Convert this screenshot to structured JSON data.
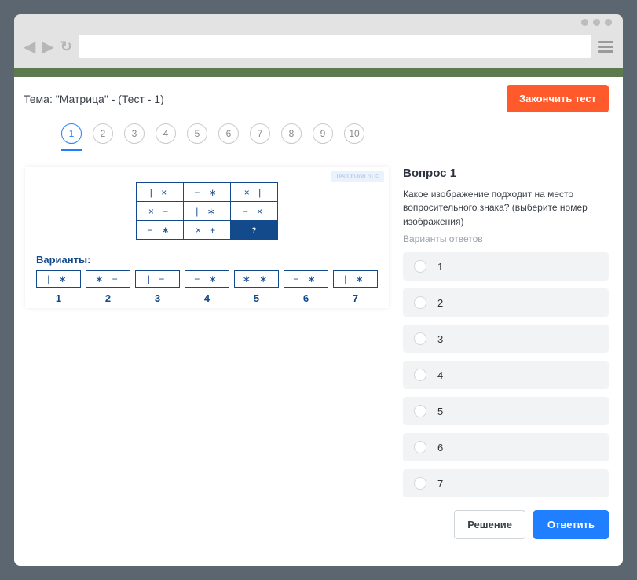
{
  "addressbar": {
    "value": ""
  },
  "topic": {
    "label": "Тема: \"Матрица\" - (Тест - 1)"
  },
  "buttons": {
    "finish": "Закончить тест",
    "solution": "Решение",
    "answer": "Ответить"
  },
  "nav": {
    "items": [
      "1",
      "2",
      "3",
      "4",
      "5",
      "6",
      "7",
      "8",
      "9",
      "10"
    ],
    "active_index": 0
  },
  "left": {
    "watermark": "TestOnJob.ru ©",
    "variants_label": "Варианты:",
    "matrix": [
      [
        "| ×",
        "− ∗",
        "× |"
      ],
      [
        "× −",
        "| ∗",
        "− ×"
      ],
      [
        "− ∗",
        "× +",
        "?"
      ]
    ],
    "variants": [
      {
        "num": "1",
        "pattern": "| ∗"
      },
      {
        "num": "2",
        "pattern": "∗ −"
      },
      {
        "num": "3",
        "pattern": "| −"
      },
      {
        "num": "4",
        "pattern": "− ∗"
      },
      {
        "num": "5",
        "pattern": "∗ ∗"
      },
      {
        "num": "6",
        "pattern": "− ∗"
      },
      {
        "num": "7",
        "pattern": "| ∗"
      }
    ]
  },
  "question": {
    "title": "Вопрос 1",
    "text": "Какое изображение подходит на место вопросительного знака? (выберите номер изображения)",
    "answers_label": "Варианты ответов",
    "answers": [
      "1",
      "2",
      "3",
      "4",
      "5",
      "6",
      "7"
    ]
  }
}
